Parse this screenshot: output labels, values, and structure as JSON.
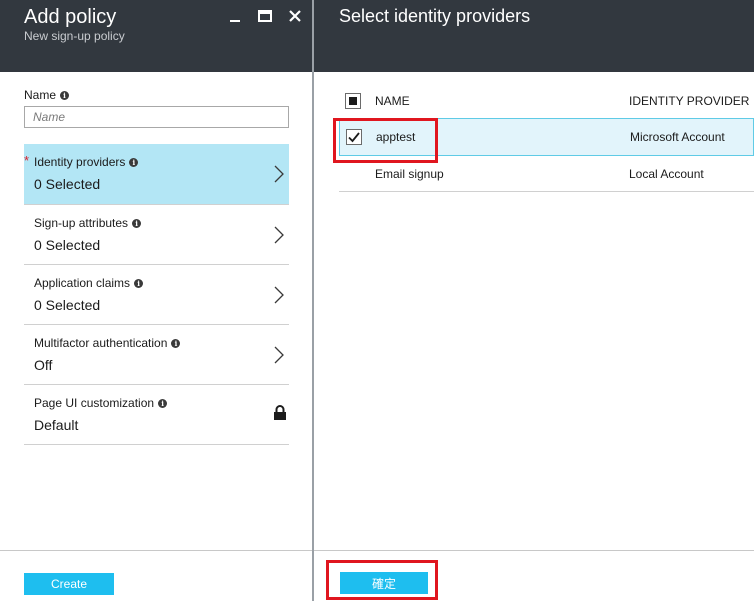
{
  "left_blade": {
    "title": "Add policy",
    "subtitle": "New sign-up policy",
    "name_label": "Name",
    "name_placeholder": "Name",
    "items": [
      {
        "title": "Identity providers",
        "value": "0 Selected",
        "required": "*"
      },
      {
        "title": "Sign-up attributes",
        "value": "0 Selected"
      },
      {
        "title": "Application claims",
        "value": "0 Selected"
      },
      {
        "title": "Multifactor authentication",
        "value": "Off"
      },
      {
        "title": "Page UI customization",
        "value": "Default"
      }
    ],
    "create_label": "Create"
  },
  "right_blade": {
    "title": "Select identity providers",
    "columns": {
      "name": "NAME",
      "provider": "IDENTITY PROVIDER"
    },
    "rows": [
      {
        "name": "apptest",
        "provider": "Microsoft Account",
        "checked": true
      },
      {
        "name": "Email signup",
        "provider": "Local Account",
        "checked": false
      }
    ],
    "ok_label": "確定"
  },
  "colors": {
    "header_bg": "#32383f",
    "accent": "#1ebeef",
    "selected_nav": "#b3e6f5",
    "selected_row": "#e2f4fb",
    "annotation": "#e0161f"
  },
  "icons": {
    "info": "info-icon",
    "chevron": "chevron-right-icon",
    "lock": "lock-icon",
    "minimize": "minimize-icon",
    "maximize": "maximize-icon",
    "close": "close-icon",
    "checkmark": "checkmark-icon"
  }
}
